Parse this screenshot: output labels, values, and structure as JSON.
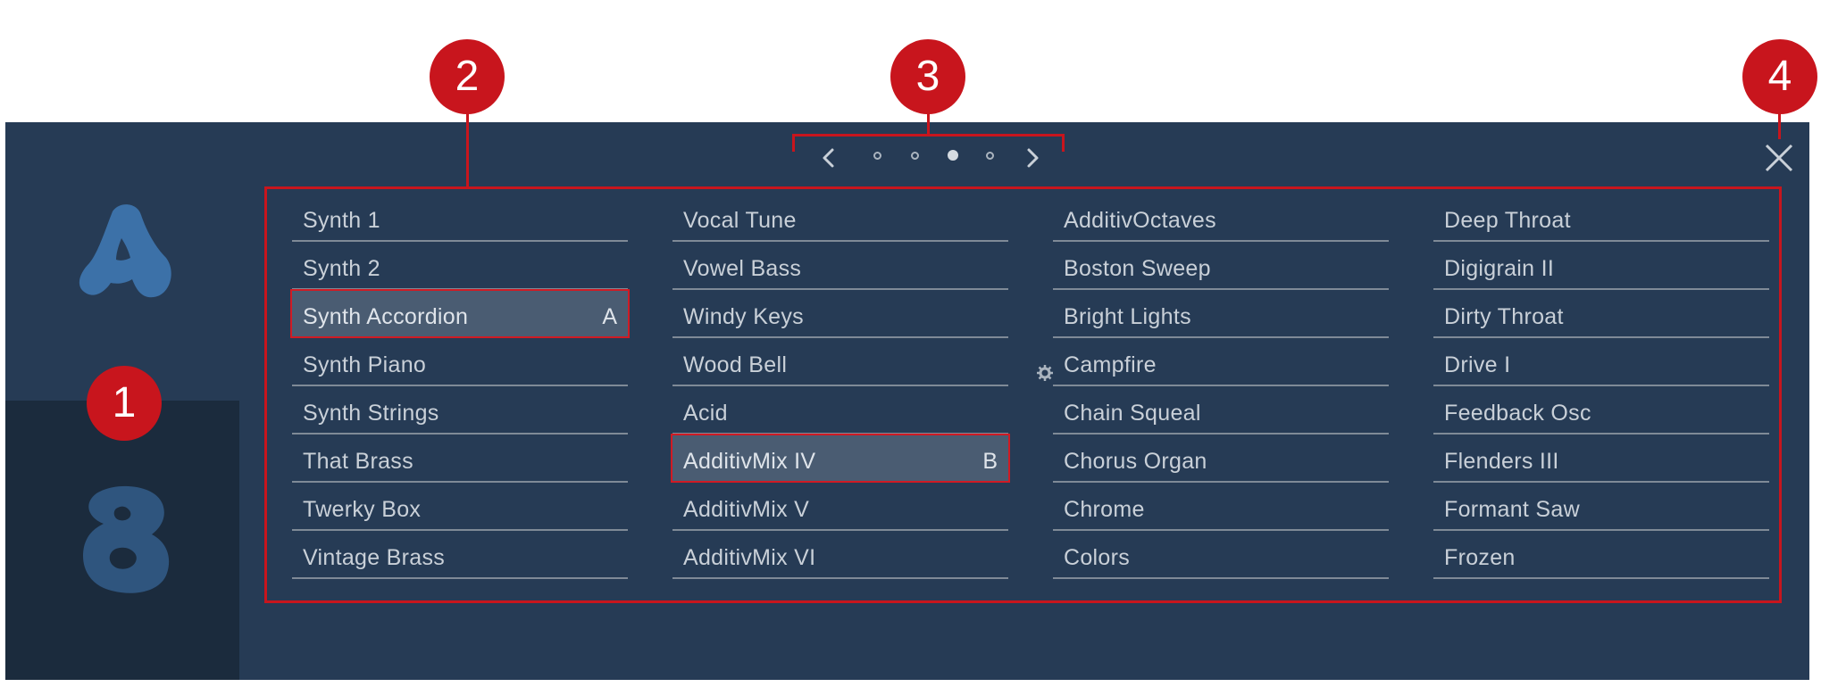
{
  "window": {
    "prev_icon": "chevron-left-icon",
    "next_icon": "chevron-right-icon",
    "close_icon": "close-icon",
    "page_dots": 4,
    "active_page": 3
  },
  "sidebar": {
    "slot_a_logo": "letter-a-logo",
    "slot_b_logo": "letter-b-logo"
  },
  "presets": {
    "columns": [
      [
        {
          "label": "Synth 1",
          "tag": ""
        },
        {
          "label": "Synth 2",
          "tag": ""
        },
        {
          "label": "Synth Accordion",
          "tag": "A"
        },
        {
          "label": "Synth Piano",
          "tag": ""
        },
        {
          "label": "Synth Strings",
          "tag": ""
        },
        {
          "label": "That Brass",
          "tag": ""
        },
        {
          "label": "Twerky Box",
          "tag": ""
        },
        {
          "label": "Vintage Brass",
          "tag": ""
        }
      ],
      [
        {
          "label": "Vocal Tune",
          "tag": ""
        },
        {
          "label": "Vowel Bass",
          "tag": ""
        },
        {
          "label": "Windy Keys",
          "tag": ""
        },
        {
          "label": "Wood Bell",
          "tag": ""
        },
        {
          "label": "Acid",
          "tag": ""
        },
        {
          "label": "AdditivMix IV",
          "tag": "B"
        },
        {
          "label": "AdditivMix V",
          "tag": ""
        },
        {
          "label": "AdditivMix VI",
          "tag": ""
        }
      ],
      [
        {
          "label": "AdditivOctaves",
          "tag": ""
        },
        {
          "label": "Boston Sweep",
          "tag": ""
        },
        {
          "label": "Bright Lights",
          "tag": ""
        },
        {
          "label": "Campfire",
          "tag": ""
        },
        {
          "label": "Chain Squeal",
          "tag": ""
        },
        {
          "label": "Chorus Organ",
          "tag": ""
        },
        {
          "label": "Chrome",
          "tag": ""
        },
        {
          "label": "Colors",
          "tag": ""
        }
      ],
      [
        {
          "label": "Deep Throat",
          "tag": ""
        },
        {
          "label": "Digigrain II",
          "tag": ""
        },
        {
          "label": "Dirty Throat",
          "tag": ""
        },
        {
          "label": "Drive I",
          "tag": ""
        },
        {
          "label": "Feedback Osc",
          "tag": ""
        },
        {
          "label": "Flenders III",
          "tag": ""
        },
        {
          "label": "Formant Saw",
          "tag": ""
        },
        {
          "label": "Frozen",
          "tag": ""
        }
      ]
    ]
  },
  "callouts": {
    "c1": "1",
    "c2": "2",
    "c3": "3",
    "c4": "4"
  },
  "colors": {
    "panel": "#263b55",
    "sidebar_b": "#1b2b3d",
    "selected_row": "#4a5c72",
    "annotation": "#c8151d"
  }
}
